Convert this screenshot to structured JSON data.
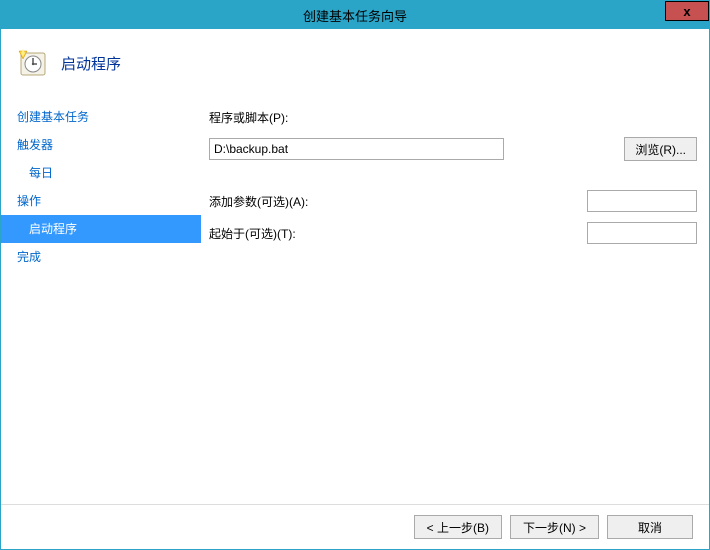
{
  "titlebar": {
    "title": "创建基本任务向导",
    "close": "x"
  },
  "header": {
    "title": "启动程序"
  },
  "sidebar": {
    "items": [
      {
        "label": "创建基本任务",
        "type": "link"
      },
      {
        "label": "触发器",
        "type": "link"
      },
      {
        "label": "每日",
        "type": "sub"
      },
      {
        "label": "操作",
        "type": "link"
      },
      {
        "label": "启动程序",
        "type": "active-sub"
      },
      {
        "label": "完成",
        "type": "link"
      }
    ]
  },
  "form": {
    "program_label": "程序或脚本(P):",
    "program_value": "D:\\backup.bat",
    "browse_label": "浏览(R)...",
    "args_label": "添加参数(可选)(A):",
    "args_value": "",
    "startin_label": "起始于(可选)(T):",
    "startin_value": ""
  },
  "footer": {
    "back": "< 上一步(B)",
    "next": "下一步(N) >",
    "cancel": "取消"
  }
}
